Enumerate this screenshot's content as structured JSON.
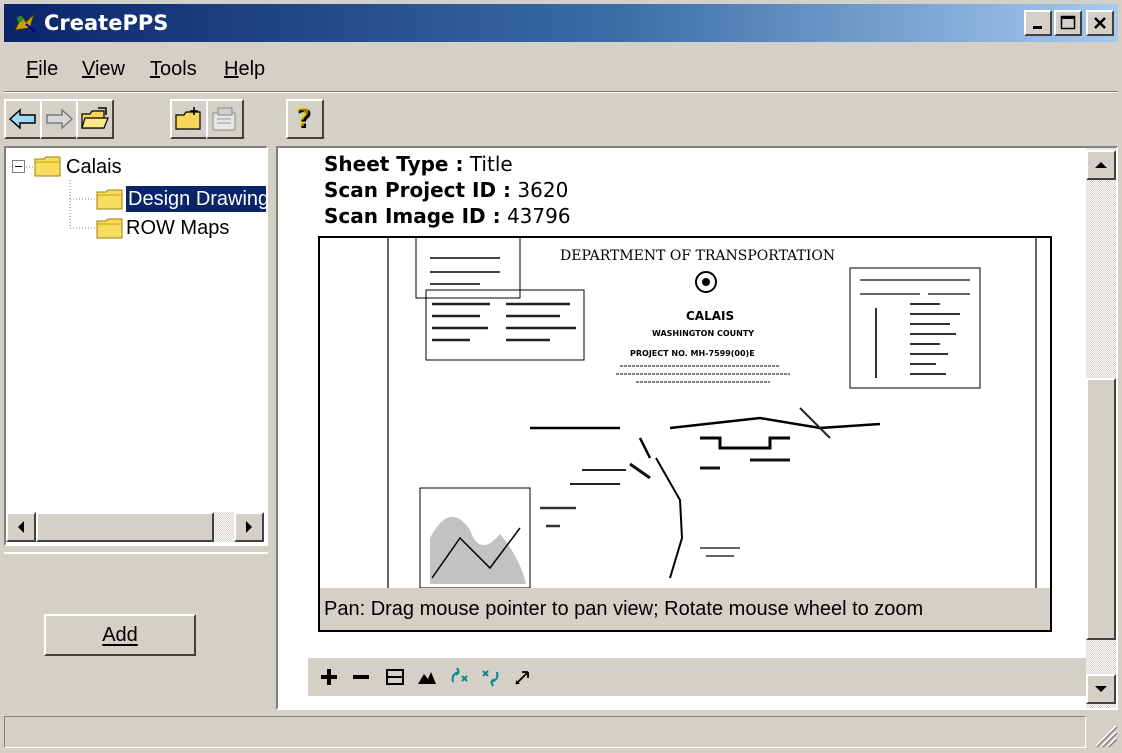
{
  "window": {
    "title": "CreatePPS",
    "controls": [
      "minimize",
      "maximize",
      "close"
    ]
  },
  "menu": [
    {
      "label": "File",
      "mnemonic": "F"
    },
    {
      "label": "View",
      "mnemonic": "V"
    },
    {
      "label": "Tools",
      "mnemonic": "T"
    },
    {
      "label": "Help",
      "mnemonic": "H"
    }
  ],
  "toolbar": {
    "buttons": [
      "back-arrow-icon",
      "forward-arrow-icon",
      "open-folder-icon",
      "new-folder-icon",
      "properties-icon",
      "help-icon"
    ]
  },
  "tree": {
    "root": {
      "label": "Calais",
      "expander": "⊟"
    },
    "children": [
      {
        "label": "Design Drawings",
        "selected": true
      },
      {
        "label": "ROW Maps",
        "selected": false
      }
    ]
  },
  "left_panel": {
    "add_button": "Add"
  },
  "viewer": {
    "sheet_type_label": "Sheet Type :",
    "sheet_type_value": "Title",
    "scan_project_label": "Scan Project ID :",
    "scan_project_value": "3620",
    "scan_image_label": "Scan Image ID :",
    "scan_image_value": "43796",
    "drawing": {
      "header": "DEPARTMENT OF TRANSPORTATION",
      "town": "CALAIS",
      "county": "WASHINGTON COUNTY",
      "project": "PROJECT NO. MH-7599(00)E"
    },
    "hint": "Pan: Drag mouse pointer to pan view; Rotate mouse wheel to zoom",
    "tools": [
      "zoom-in-icon",
      "zoom-out-icon",
      "fit-window-icon",
      "fit-image-icon",
      "rotate-left-icon",
      "rotate-right-icon",
      "pan-icon"
    ]
  },
  "colors": {
    "titlebar_start": "#0a246a",
    "titlebar_end": "#a6caf0",
    "face": "#d4d0c8",
    "selection": "#0a246a"
  }
}
